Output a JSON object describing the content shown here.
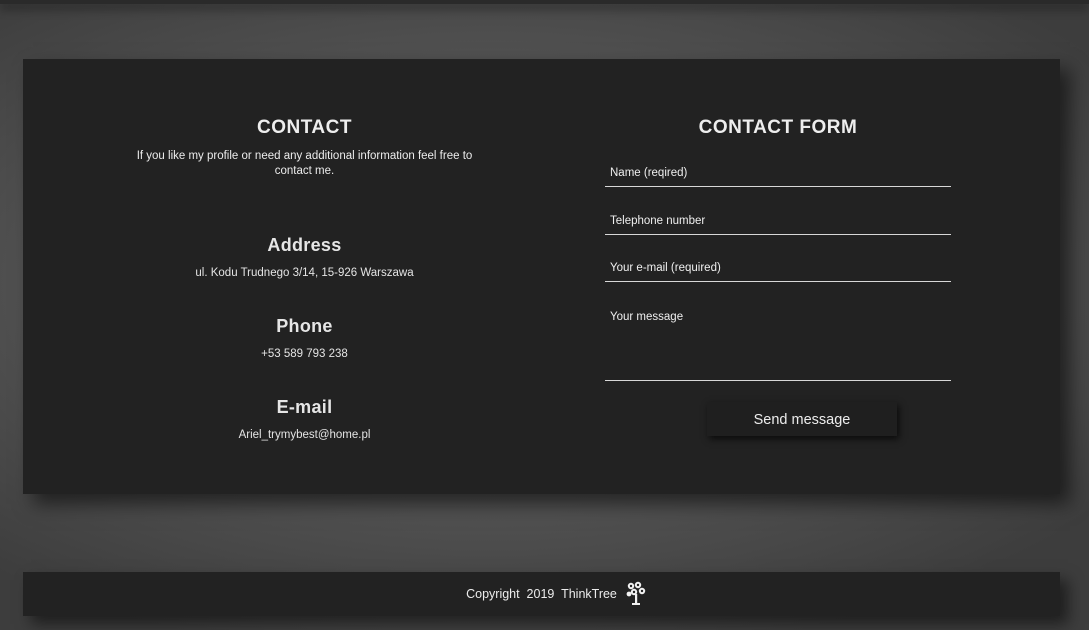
{
  "contact": {
    "title": "CONTACT",
    "description": "If you like my profile or need any additional information feel free to contact me.",
    "address": {
      "label": "Address",
      "value": "ul. Kodu Trudnego 3/14, 15-926 Warszawa"
    },
    "phone": {
      "label": "Phone",
      "value": "+53 589 793 238"
    },
    "email": {
      "label": "E-mail",
      "value": "Ariel_trymybest@home.pl"
    }
  },
  "form": {
    "title": "CONTACT FORM",
    "name_placeholder": "Name (reqired)",
    "phone_placeholder": "Telephone number",
    "email_placeholder": "Your e-mail (required)",
    "message_placeholder": "Your message",
    "send_label": "Send message"
  },
  "footer": {
    "copyright_text": "Copyright  2019  ThinkTree",
    "icon": "tree-icon"
  },
  "colors": {
    "panel": "#222222",
    "text": "#eeeeee",
    "background": "#5a5a5a"
  }
}
